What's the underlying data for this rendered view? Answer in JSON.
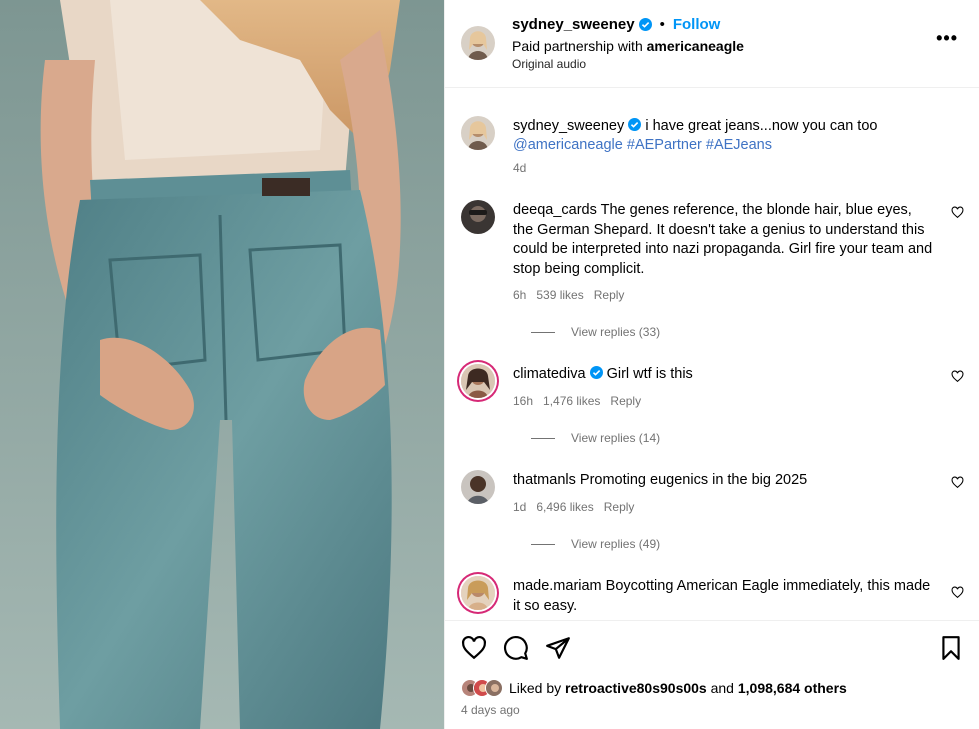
{
  "header": {
    "username": "sydney_sweeney",
    "follow_label": "Follow",
    "separator": "•",
    "partnership_prefix": "Paid partnership with",
    "partner": "americaneagle",
    "audio": "Original audio",
    "more_label": "•••"
  },
  "caption": {
    "username": "sydney_sweeney",
    "text": "i have great jeans...now you can too",
    "mention": "@americaneagle",
    "hashtag1": "#AEPartner",
    "hashtag2": "#AEJeans",
    "time": "4d"
  },
  "comments": [
    {
      "username": "deeqa_cards",
      "text": "The genes reference, the blonde hair, blue eyes, the German Shepard. It doesn't take a genius to understand this could be interpreted into nazi propaganda. Girl fire your team and stop being complicit.",
      "time": "6h",
      "likes": "539 likes",
      "reply": "Reply",
      "view_replies": "View replies (33)"
    },
    {
      "username": "climatediva",
      "text": "Girl wtf is this",
      "time": "16h",
      "likes": "1,476 likes",
      "reply": "Reply",
      "view_replies": "View replies (14)"
    },
    {
      "username": "thatmanls",
      "text": "Promoting eugenics in the big 2025",
      "time": "1d",
      "likes": "6,496 likes",
      "reply": "Reply",
      "view_replies": "View replies (49)"
    },
    {
      "username": "made.mariam",
      "text": "Boycotting American Eagle immediately, this made it so easy."
    }
  ],
  "footer": {
    "liked_by_prefix": "Liked by",
    "liked_by_user": "retroactive80s90s00s",
    "and_label": "and",
    "others_count": "1,098,684 others",
    "post_time": "4 days ago"
  },
  "icons": {
    "like": "heart-icon",
    "comment": "comment-icon",
    "share": "share-icon",
    "save": "bookmark-icon",
    "verified": "verified-badge-icon",
    "more": "more-options-icon"
  },
  "colors": {
    "link_blue": "#0095f6",
    "hashtag_blue": "#3f73c4",
    "verified_blue": "#0095f6",
    "muted_gray": "#737373",
    "story_ring": "#d62976"
  }
}
